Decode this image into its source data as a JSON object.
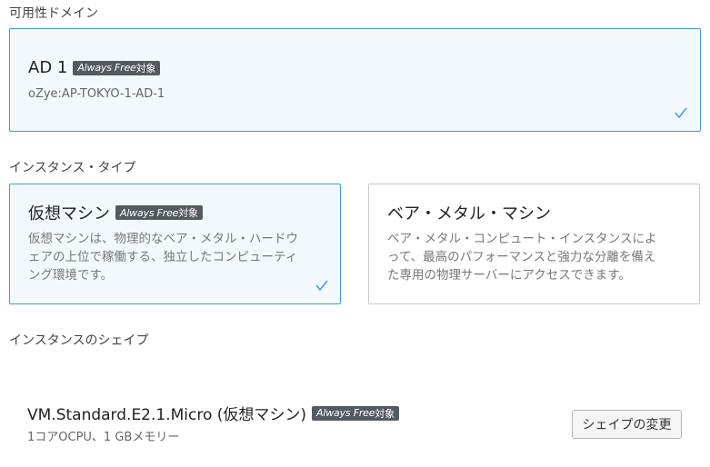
{
  "availability_domain": {
    "section_label": "可用性ドメイン",
    "card": {
      "title": "AD 1",
      "badge_always_free": "Always Free",
      "badge_suffix": "対象",
      "subtitle": "oZye:AP-TOKYO-1-AD-1",
      "selected": true
    }
  },
  "instance_type": {
    "section_label": "インスタンス・タイプ",
    "options": [
      {
        "title": "仮想マシン",
        "badge_always_free": "Always Free",
        "badge_suffix": "対象",
        "description_lines": [
          "仮想マシンは、物理的なベア・メタル・ハードウ",
          "ェアの上位で稼働する、独立したコンピューティ",
          "ング環境です。"
        ],
        "selected": true
      },
      {
        "title": "ベア・メタル・マシン",
        "description_lines": [
          "ベア・メタル・コンピュート・インスタンスによ",
          "って、最高のパフォーマンスと強力な分離を備え",
          "た専用の物理サーバーにアクセスできます。"
        ],
        "selected": false
      }
    ]
  },
  "shape": {
    "section_label": "インスタンスのシェイプ",
    "name": "VM.Standard.E2.1.Micro (仮想マシン)",
    "badge_always_free": "Always Free",
    "badge_suffix": "対象",
    "specs": "1コアOCPU、1 GBメモリー",
    "change_button_label": "シェイプの変更"
  },
  "colors": {
    "accent": "#4a98d6",
    "badge_bg": "#555a60",
    "selected_bg": "#f3f8fd"
  }
}
